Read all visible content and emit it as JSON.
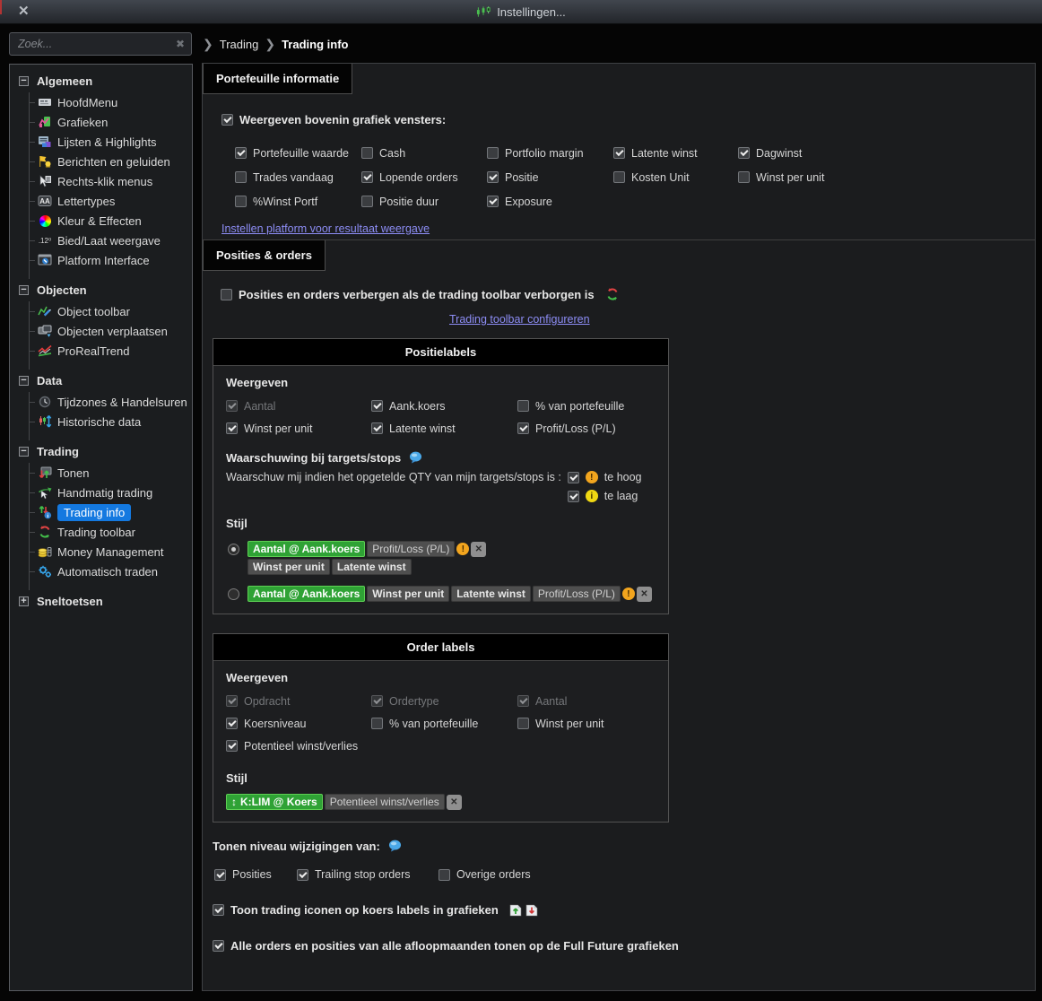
{
  "window": {
    "title": "Instellingen...",
    "close": "✕"
  },
  "search": {
    "placeholder": "Zoek...",
    "clear_icon": "✖"
  },
  "breadcrumb": {
    "sep": "❯",
    "parent": "Trading",
    "current": "Trading info"
  },
  "sidebar": {
    "sections": [
      {
        "label": "Algemeen",
        "collapsed": false,
        "items": [
          {
            "label": "HoofdMenu",
            "icon": "main-menu-icon"
          },
          {
            "label": "Grafieken",
            "icon": "charts-icon"
          },
          {
            "label": "Lijsten & Highlights",
            "icon": "lists-highlights-icon"
          },
          {
            "label": "Berichten en geluiden",
            "icon": "alerts-sounds-icon"
          },
          {
            "label": "Rechts-klik menus",
            "icon": "context-menu-icon"
          },
          {
            "label": "Lettertypes",
            "icon": "fonts-icon"
          },
          {
            "label": "Kleur & Effecten",
            "icon": "colors-effects-icon"
          },
          {
            "label": "Bied/Laat weergave",
            "icon": "bid-ask-icon"
          },
          {
            "label": "Platform Interface",
            "icon": "platform-interface-icon"
          }
        ]
      },
      {
        "label": "Objecten",
        "collapsed": false,
        "items": [
          {
            "label": "Object toolbar",
            "icon": "object-toolbar-icon"
          },
          {
            "label": "Objecten verplaatsen",
            "icon": "move-objects-icon"
          },
          {
            "label": "ProRealTrend",
            "icon": "prorealtrend-icon"
          }
        ]
      },
      {
        "label": "Data",
        "collapsed": false,
        "items": [
          {
            "label": "Tijdzones & Handelsuren",
            "icon": "timezones-icon"
          },
          {
            "label": "Historische data",
            "icon": "historical-data-icon"
          }
        ]
      },
      {
        "label": "Trading",
        "collapsed": false,
        "items": [
          {
            "label": "Tonen",
            "icon": "show-icon"
          },
          {
            "label": "Handmatig trading",
            "icon": "manual-trading-icon"
          },
          {
            "label": "Trading info",
            "icon": "trading-info-icon",
            "selected": true
          },
          {
            "label": "Trading toolbar",
            "icon": "trading-toolbar-icon"
          },
          {
            "label": "Money Management",
            "icon": "money-management-icon"
          },
          {
            "label": "Automatisch traden",
            "icon": "auto-trading-icon"
          }
        ]
      },
      {
        "label": "Sneltoetsen",
        "collapsed": true,
        "items": []
      }
    ]
  },
  "portfolio": {
    "tab": "Portefeuille informatie",
    "master": {
      "label": "Weergeven bovenin grafiek vensters:",
      "checked": true
    },
    "grid": [
      [
        {
          "label": "Portefeuille waarde",
          "checked": true
        },
        {
          "label": "Cash",
          "checked": false
        },
        {
          "label": "Portfolio margin",
          "checked": false
        },
        {
          "label": "Latente winst",
          "checked": true
        },
        {
          "label": "Dagwinst",
          "checked": true
        }
      ],
      [
        {
          "label": "Trades vandaag",
          "checked": false
        },
        {
          "label": "Lopende orders",
          "checked": true
        },
        {
          "label": "Positie",
          "checked": true
        },
        {
          "label": "Kosten Unit",
          "checked": false
        },
        {
          "label": "Winst per unit",
          "checked": false
        }
      ],
      [
        {
          "label": "%Winst Portf",
          "checked": false
        },
        {
          "label": "Positie duur",
          "checked": false
        },
        {
          "label": "Exposure",
          "checked": true
        }
      ]
    ],
    "link": "Instellen platform voor resultaat weergave"
  },
  "positions": {
    "tab": "Posities & orders",
    "hide_checkbox": {
      "label": "Posities en orders verbergen als de trading toolbar verborgen is",
      "checked": false
    },
    "link": "Trading toolbar configureren",
    "position_labels": {
      "title": "Positielabels",
      "weergeven_label": "Weergeven",
      "grid": [
        [
          {
            "label": "Aantal",
            "checked": true,
            "disabled": true
          },
          {
            "label": "Aank.koers",
            "checked": true
          },
          {
            "label": "% van portefeuille",
            "checked": false
          }
        ],
        [
          {
            "label": "Winst per unit",
            "checked": true
          },
          {
            "label": "Latente winst",
            "checked": true
          },
          {
            "label": "Profit/Loss (P/L)",
            "checked": true
          }
        ]
      ],
      "warning_title": "Waarschuwing bij targets/stops",
      "warning_text": "Waarschuw mij indien het opgetelde QTY van mijn targets/stops is :",
      "warning_options": [
        {
          "label": "te hoog",
          "checked": true,
          "icon": "warning-badge"
        },
        {
          "label": "te laag",
          "checked": true,
          "icon": "info-badge"
        }
      ],
      "style_label": "Stijl",
      "style_options": [
        {
          "selected": true,
          "lines": [
            [
              {
                "text": "Aantal @ Aank.koers"
              },
              {
                "text": "Profit/Loss (P/L)"
              }
            ],
            [
              {
                "text": "Winst per unit"
              },
              {
                "text": "Latente winst"
              }
            ]
          ]
        },
        {
          "selected": false,
          "lines": [
            [
              {
                "text": "Aantal @ Aank.koers"
              },
              {
                "text": "Winst per unit"
              },
              {
                "text": "Latente winst"
              },
              {
                "text": "Profit/Loss (P/L)"
              }
            ]
          ]
        }
      ]
    },
    "order_labels": {
      "title": "Order labels",
      "weergeven_label": "Weergeven",
      "grid": [
        [
          {
            "label": "Opdracht",
            "checked": true,
            "disabled": true
          },
          {
            "label": "Ordertype",
            "checked": true,
            "disabled": true
          },
          {
            "label": "Aantal",
            "checked": true,
            "disabled": true
          }
        ],
        [
          {
            "label": "Koersniveau",
            "checked": true
          },
          {
            "label": "% van portefeuille",
            "checked": false
          },
          {
            "label": "Winst per unit",
            "checked": false
          }
        ],
        [
          {
            "label": "Potentieel winst/verlies",
            "checked": true
          }
        ]
      ],
      "style_label": "Stijl",
      "style_chips": [
        {
          "text": "K:LIM @ Koers",
          "arrow": "↕"
        },
        {
          "text": "Potentieel winst/verlies"
        }
      ]
    },
    "bottom": {
      "tonen_title": "Tonen niveau wijzigingen van:",
      "options": [
        {
          "label": "Posities",
          "checked": true
        },
        {
          "label": "Trailing stop orders",
          "checked": true
        },
        {
          "label": "Overige orders",
          "checked": false
        }
      ],
      "icons_checkbox": {
        "label": "Toon trading iconen op koers labels in grafieken",
        "checked": true
      },
      "full_future_checkbox": {
        "label": "Alle orders en posities van alle afloopmaanden tonen op de Full Future grafieken",
        "checked": true
      }
    }
  },
  "colors": {
    "accent_blue": "#1479e0",
    "chip_green": "#2fa235",
    "warn_orange": "#f2a51e",
    "info_yellow": "#f0d813",
    "link_purple": "#8d8df5"
  }
}
